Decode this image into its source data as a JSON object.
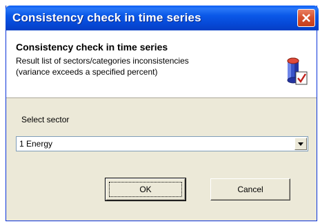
{
  "window": {
    "title": "Consistency check in time series"
  },
  "header": {
    "title": "Consistency check in time series",
    "description_line1": "Result list of sectors/categories inconsistencies",
    "description_line2": "(variance exceeds a specified percent)",
    "icon": "database-check-icon"
  },
  "form": {
    "select_label": "Select sector",
    "selected_sector": "1 Energy"
  },
  "buttons": {
    "ok_label": "OK",
    "cancel_label": "Cancel"
  },
  "colors": {
    "titlebar": "#0a58e8",
    "close_button": "#d64f2c",
    "dialog_background": "#ece9d8"
  }
}
